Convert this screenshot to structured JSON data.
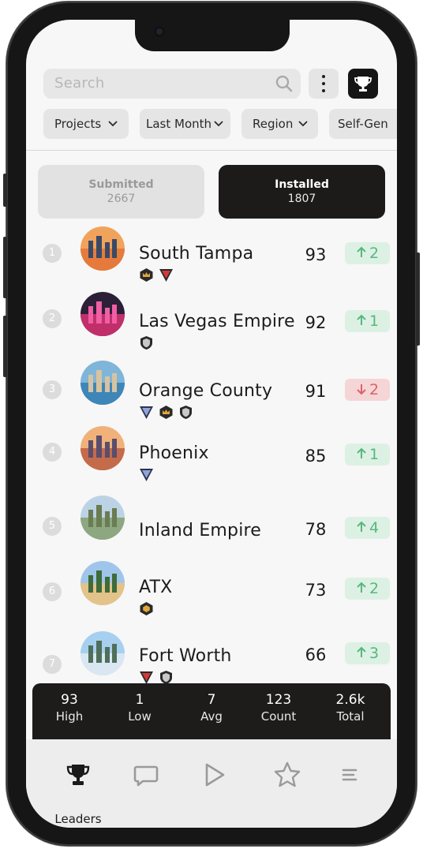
{
  "search": {
    "placeholder": "Search"
  },
  "filters": [
    {
      "label": "Projects"
    },
    {
      "label": "Last Month"
    },
    {
      "label": "Region"
    },
    {
      "label": "Self-Gen"
    }
  ],
  "toggle": {
    "submitted": {
      "label": "Submitted",
      "value": "2667"
    },
    "installed": {
      "label": "Installed",
      "value": "1807"
    },
    "active": "installed"
  },
  "leaders": [
    {
      "rank": "1",
      "name": "South Tampa",
      "score": "93",
      "change": "2",
      "direction": "up",
      "badges": [
        "gold-crown-badge",
        "red-chevron-badge"
      ]
    },
    {
      "rank": "2",
      "name": "Las Vegas Empire",
      "score": "92",
      "change": "1",
      "direction": "up",
      "badges": [
        "silver-shield-badge"
      ]
    },
    {
      "rank": "3",
      "name": "Orange County",
      "score": "91",
      "change": "2",
      "direction": "down",
      "badges": [
        "blue-chevron-badge",
        "gold-crown-badge",
        "silver-shield-badge"
      ]
    },
    {
      "rank": "4",
      "name": "Phoenix",
      "score": "85",
      "change": "1",
      "direction": "up",
      "badges": [
        "blue-chevron-badge"
      ]
    },
    {
      "rank": "5",
      "name": "Inland Empire",
      "score": "78",
      "change": "4",
      "direction": "up",
      "badges": []
    },
    {
      "rank": "6",
      "name": "ATX",
      "score": "73",
      "change": "2",
      "direction": "up",
      "badges": [
        "gold-hexagon-badge"
      ]
    },
    {
      "rank": "7",
      "name": "Fort Worth",
      "score": "66",
      "change": "3",
      "direction": "up",
      "badges": [
        "red-chevron-badge",
        "silver-shield-badge"
      ]
    }
  ],
  "stats": [
    {
      "value": "93",
      "label": "High"
    },
    {
      "value": "1",
      "label": "Low"
    },
    {
      "value": "7",
      "label": "Avg"
    },
    {
      "value": "123",
      "label": "Count"
    },
    {
      "value": "2.6k",
      "label": "Total"
    }
  ],
  "nav": {
    "items": [
      {
        "icon": "trophy-icon",
        "label": "Leaders",
        "active": true
      },
      {
        "icon": "chat-icon"
      },
      {
        "icon": "play-icon"
      },
      {
        "icon": "star-icon"
      },
      {
        "icon": "menu-icon"
      }
    ]
  },
  "colors": {
    "accent_dark": "#1d1a1a",
    "up_bg": "#dcf1e4",
    "up_text": "#58b77d",
    "down_bg": "#f6d5d7",
    "down_text": "#d9636b"
  }
}
